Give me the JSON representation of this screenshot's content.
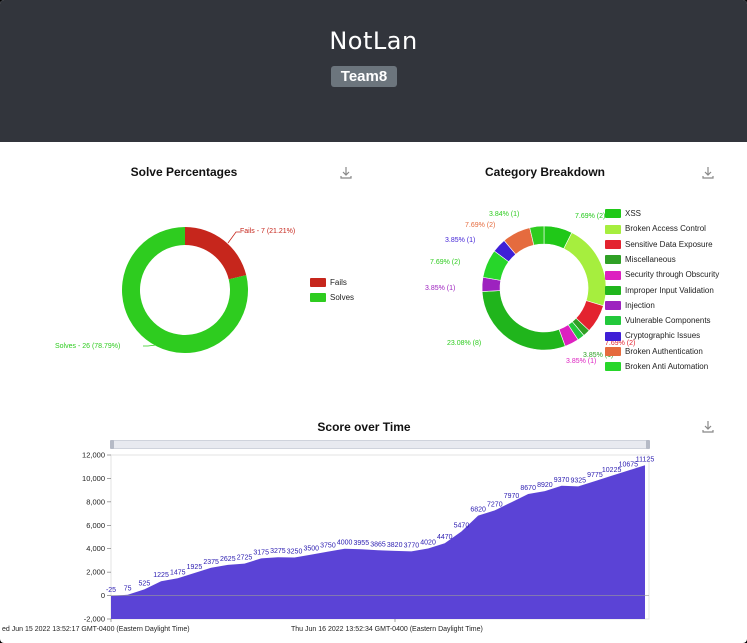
{
  "header": {
    "title": "NotLan",
    "badge": "Team8"
  },
  "solve_percentages": {
    "title": "Solve Percentages",
    "download_icon": "download-icon",
    "fails_label": "Fails - 7 (21.21%)",
    "solves_label": "Solves - 26 (78.79%)",
    "legend": [
      "Fails",
      "Solves"
    ],
    "colors": {
      "fails": "#c6261c",
      "solves": "#2ecc1f"
    }
  },
  "category_breakdown": {
    "title": "Category Breakdown",
    "download_icon": "download-icon",
    "legend": [
      {
        "name": "XSS",
        "color": "#20c818"
      },
      {
        "name": "Broken Access Control",
        "color": "#a6ee3e"
      },
      {
        "name": "Sensitive Data Exposure",
        "color": "#e3232f"
      },
      {
        "name": "Miscellaneous",
        "color": "#2fa025"
      },
      {
        "name": "Security through Obscurity",
        "color": "#dd21c0"
      },
      {
        "name": "Improper Input Validation",
        "color": "#20b51c"
      },
      {
        "name": "Injection",
        "color": "#9d22bf"
      },
      {
        "name": "Vulnerable Components",
        "color": "#22c83b"
      },
      {
        "name": "Cryptographic Issues",
        "color": "#3f1fd6"
      },
      {
        "name": "Broken Authentication",
        "color": "#e56b3e"
      },
      {
        "name": "Broken Anti Automation",
        "color": "#27d62a"
      }
    ],
    "slice_labels": {
      "xss": "7.69% (2)",
      "top_green": "3.84% (1)",
      "orange": "7.69% (2)",
      "blue": "3.85% (1)",
      "left_green": "7.69% (2)",
      "purple": "3.85% (1)",
      "big_green": "23.08% (8)",
      "red_bottom": "7.69% (2)",
      "bottom_a": "3.85% (1)",
      "bottom_b": "3.85% (1)"
    }
  },
  "score_over_time": {
    "title": "Score over Time",
    "download_icon": "download-icon",
    "x_start_label": "ed Jun 15 2022 13:52:17 GMT-0400 (Eastern Daylight Time)",
    "x_mid_label": "Thu Jun 16 2022 13:52:34 GMT-0400 (Eastern Daylight Time)",
    "fill_color": "#5b43d6"
  },
  "chart_data": [
    {
      "type": "pie",
      "title": "Solve Percentages",
      "labels": [
        "Fails",
        "Solves"
      ],
      "values": [
        7,
        26
      ]
    },
    {
      "type": "pie",
      "title": "Category Breakdown",
      "labels": [
        "XSS",
        "Broken Access Control",
        "Sensitive Data Exposure",
        "Miscellaneous",
        "Security through Obscurity",
        "Improper Input Validation",
        "Injection",
        "Vulnerable Components",
        "Cryptographic Issues",
        "Broken Authentication",
        "Broken Anti Automation"
      ],
      "values": [
        2,
        6,
        2,
        1,
        1,
        8,
        1,
        2,
        1,
        2,
        1
      ]
    },
    {
      "type": "area",
      "title": "Score over Time",
      "ylim": [
        -2000,
        12000
      ],
      "yticks": [
        "12,000",
        "10,000",
        "8,000",
        "6,000",
        "4,000",
        "2,000",
        "0",
        "-2,000"
      ],
      "values": [
        -25,
        75,
        525,
        1225,
        1475,
        1925,
        2375,
        2625,
        2725,
        3175,
        3275,
        3250,
        3500,
        3750,
        4000,
        3955,
        3865,
        3820,
        3770,
        4020,
        4470,
        5470,
        6820,
        7270,
        7970,
        8670,
        8920,
        9370,
        9325,
        9775,
        10225,
        10675,
        11125
      ],
      "value_labels": [
        "-25",
        "75",
        "525",
        "1225",
        "1475",
        "1925",
        "2375",
        "2625",
        "2725",
        "3175",
        "3275",
        "3250",
        "3500",
        "3750",
        "4000",
        "3955",
        "3865",
        "3820",
        "3770",
        "4020",
        "4470",
        "5470",
        "6820",
        "7270",
        "7970",
        "8670",
        "8920",
        "9370",
        "9325",
        "9775",
        "10225",
        "10675",
        "11125"
      ]
    }
  ]
}
